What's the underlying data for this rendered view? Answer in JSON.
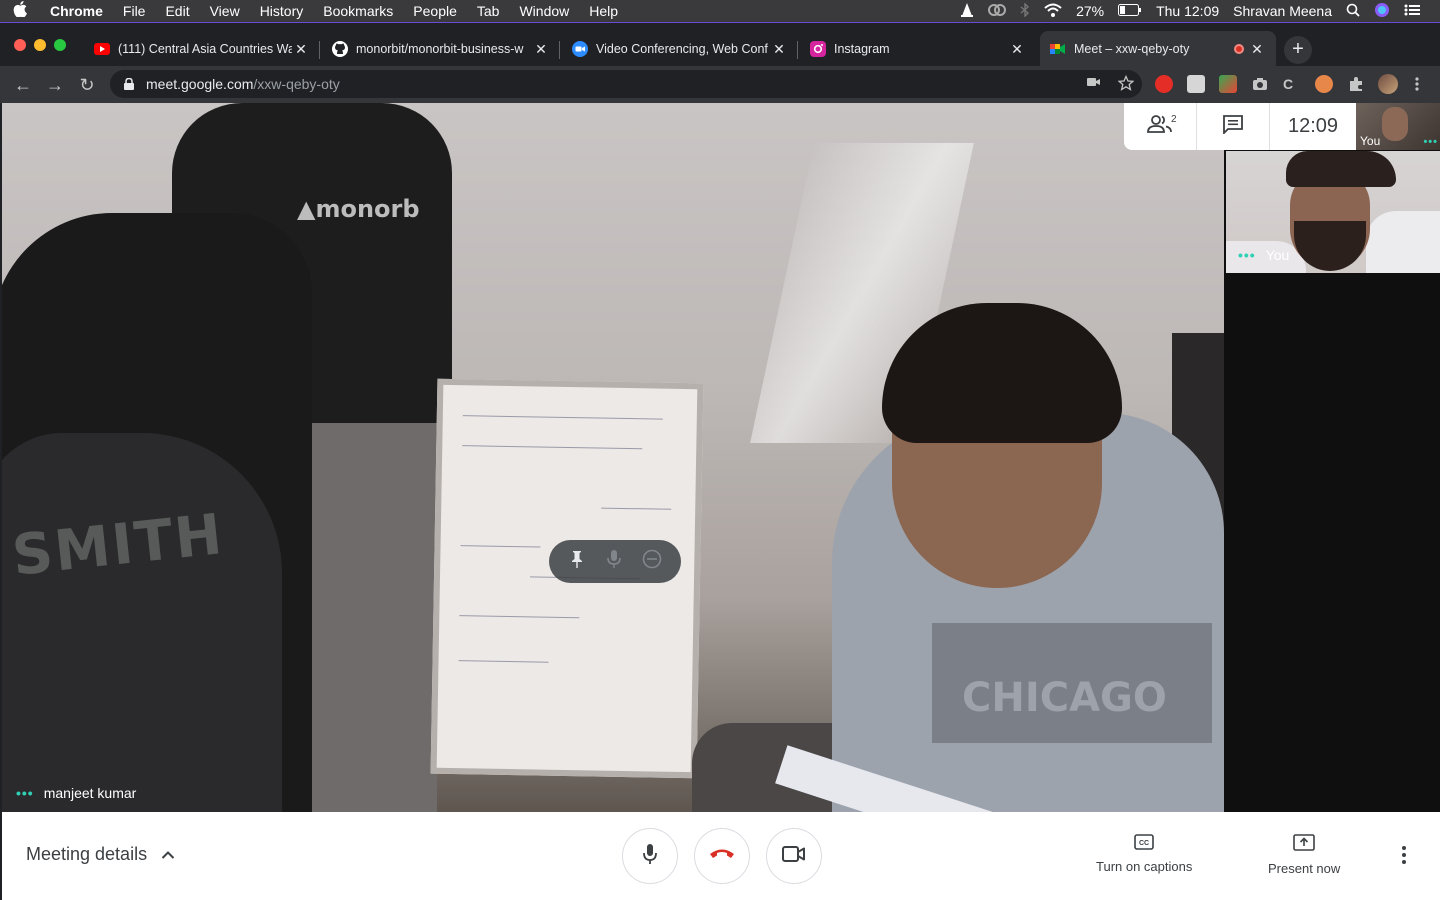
{
  "menubar": {
    "app": "Chrome",
    "items": [
      "File",
      "Edit",
      "View",
      "History",
      "Bookmarks",
      "People",
      "Tab",
      "Window",
      "Help"
    ],
    "battery": "27%",
    "clock": "Thu 12:09",
    "user": "Shravan Meena"
  },
  "tabs": [
    {
      "title": "(111) Central Asia Countries Wa",
      "icon": "youtube-icon"
    },
    {
      "title": "monorbit/monorbit-business-w",
      "icon": "github-icon"
    },
    {
      "title": "Video Conferencing, Web Conf",
      "icon": "zoom-icon"
    },
    {
      "title": "Instagram",
      "icon": "instagram-icon"
    },
    {
      "title": "Meet – xxw-qeby-oty",
      "icon": "meet-icon",
      "active": true
    }
  ],
  "omnibox": {
    "host": "meet.google.com",
    "path": "/xxw-qeby-oty"
  },
  "meeting": {
    "main_participant": "manjeet kumar",
    "participant_count": "2",
    "clock": "12:09",
    "self_label": "You",
    "self_tile_label": "You"
  },
  "bottombar": {
    "meeting_details": "Meeting details",
    "captions": "Turn on captions",
    "present": "Present now"
  },
  "colors": {
    "accent": "#1a73e8",
    "end_call": "#d93025",
    "speaking_dots": "#2fd0b4"
  }
}
